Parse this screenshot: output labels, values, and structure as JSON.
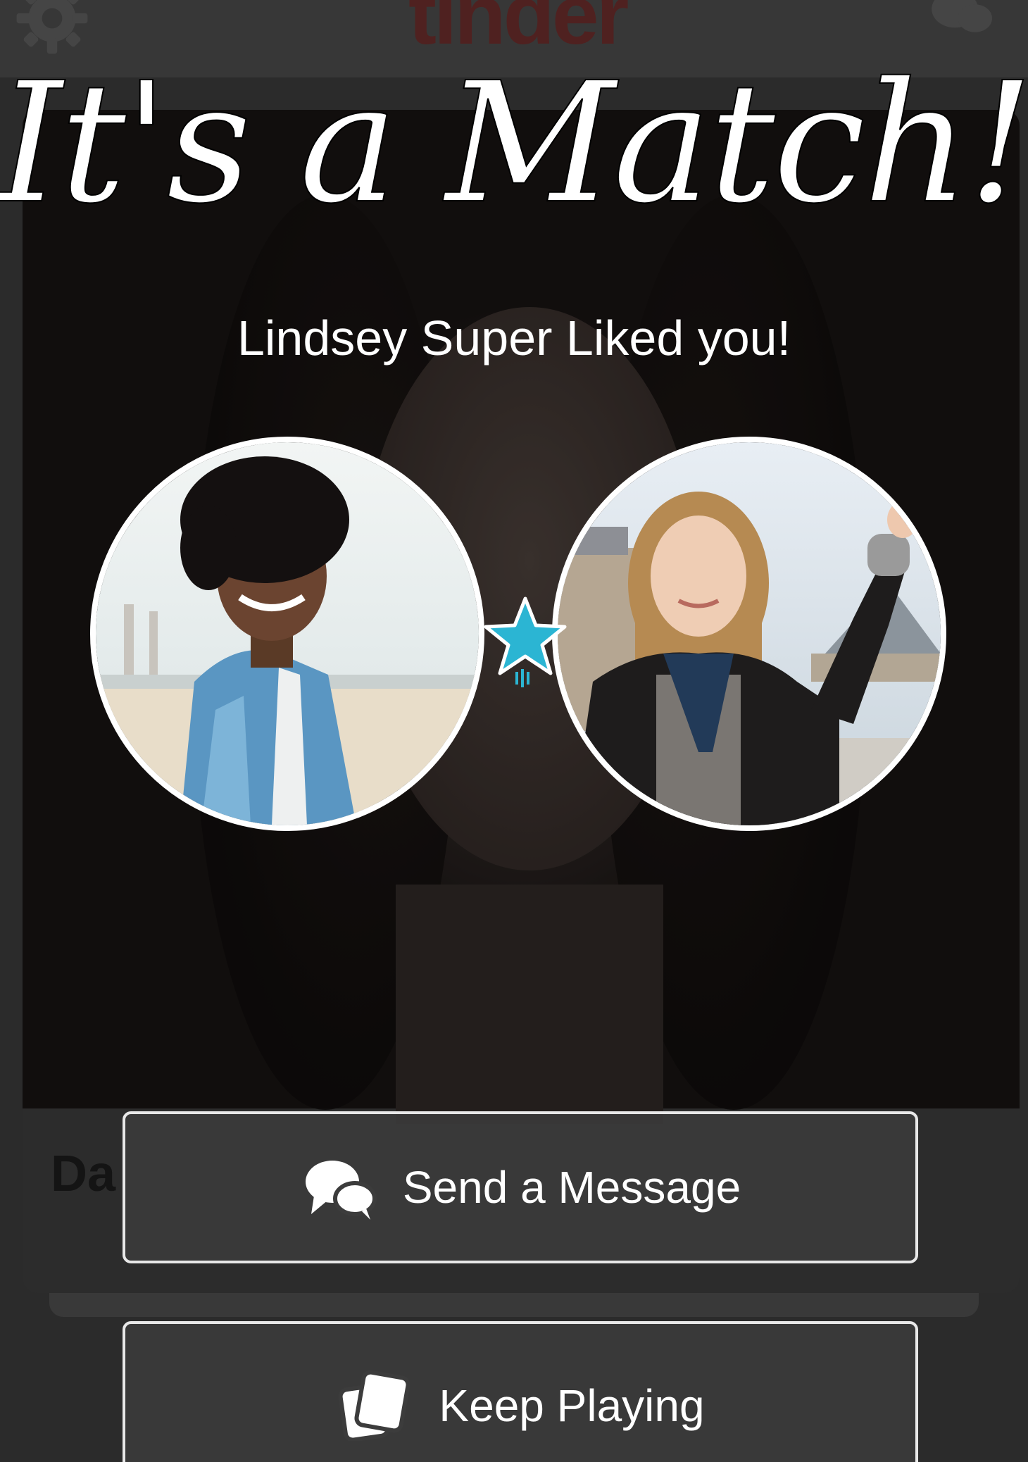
{
  "app": {
    "brand": "tinder",
    "card_name_partial": "Da"
  },
  "overlay": {
    "title": "It's a Match!",
    "subtitle": "Lindsey Super Liked you!",
    "accent_color": "#2bb5d3"
  },
  "avatars": {
    "left": "user-profile-photo",
    "right": "lindsey-profile-photo"
  },
  "icons": {
    "settings": "gear-icon",
    "messages": "chat-bubbles-icon",
    "super_like": "star-icon",
    "send_message": "chat-bubbles-icon",
    "keep_playing": "cards-icon"
  },
  "actions": {
    "send_message_label": "Send a Message",
    "keep_playing_label": "Keep Playing"
  }
}
